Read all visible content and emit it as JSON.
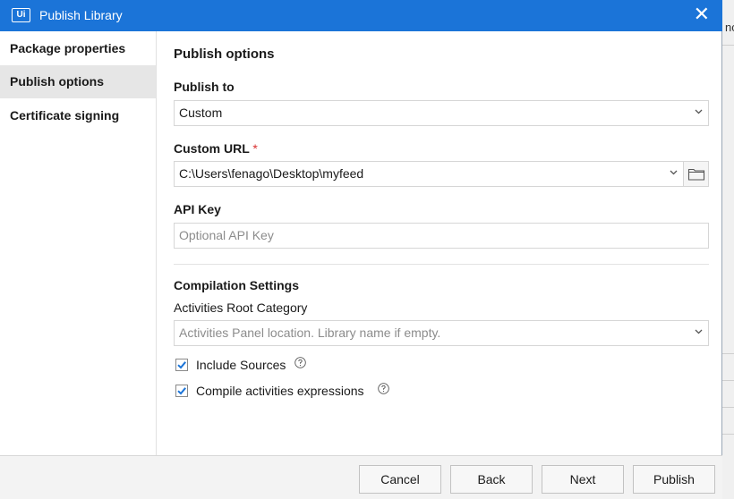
{
  "window": {
    "title": "Publish Library",
    "logo_text": "Ui",
    "close_glyph": "✕",
    "background_text": "nc"
  },
  "sidebar": {
    "items": [
      {
        "label": "Package properties",
        "active": false
      },
      {
        "label": "Publish options",
        "active": true
      },
      {
        "label": "Certificate signing",
        "active": false
      }
    ]
  },
  "main": {
    "title": "Publish options",
    "publish_to": {
      "label": "Publish to",
      "value": "Custom"
    },
    "custom_url": {
      "label": "Custom URL",
      "required_mark": "*",
      "value": "C:\\Users\\fenago\\Desktop\\myfeed"
    },
    "api_key": {
      "label": "API Key",
      "value": "",
      "placeholder": "Optional API Key"
    },
    "compilation": {
      "heading": "Compilation Settings",
      "root_category_label": "Activities Root Category",
      "root_category_placeholder": "Activities Panel location. Library name if empty."
    },
    "checkboxes": [
      {
        "label": "Include Sources",
        "checked": true
      },
      {
        "label": "Compile activities expressions",
        "checked": true
      }
    ]
  },
  "footer": {
    "cancel": "Cancel",
    "back": "Back",
    "next": "Next",
    "publish": "Publish"
  },
  "colors": {
    "titlebar": "#1b74d8",
    "checkbox_accent": "#1b74d8",
    "selected_nav": "#e6e6e6"
  },
  "icons": [
    "ui-logo-icon",
    "close-icon",
    "chevron-down-icon",
    "folder-icon",
    "checkbox-checked-icon",
    "help-icon"
  ]
}
